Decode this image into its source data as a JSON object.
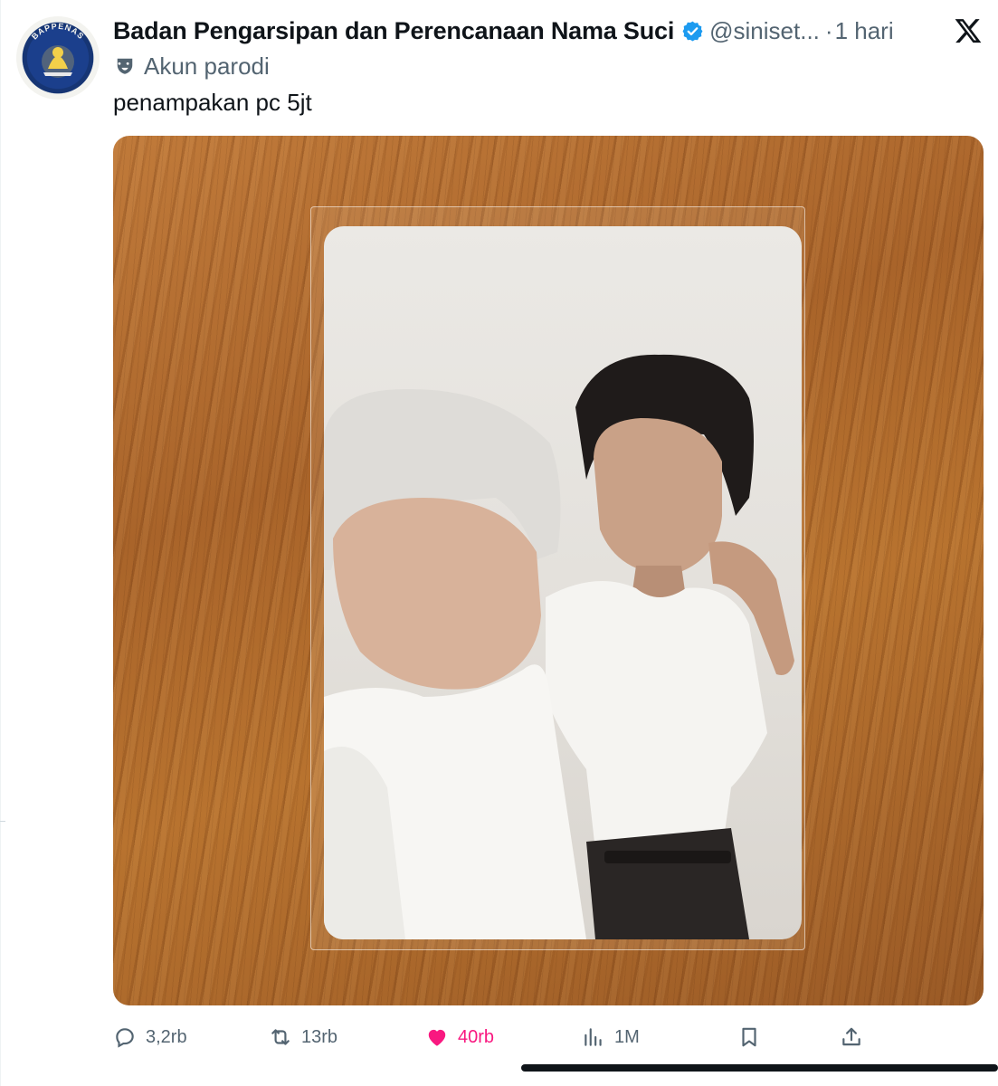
{
  "post": {
    "display_name": "Badan Pengarsipan dan Perencanaan Nama Suci",
    "handle": "@siniset...",
    "separator": "·",
    "time": "1 hari",
    "label": "Akun parodi",
    "text": "penampakan pc 5jt"
  },
  "avatar": {
    "top_text": "BAPPENAS",
    "ring_text": "Badan Pengarsipan dan Perencanaan Nama Suci"
  },
  "media": {
    "description_icon": "photo"
  },
  "actions": {
    "reply_count": "3,2rb",
    "repost_count": "13rb",
    "like_count": "40rb",
    "view_count": "1M"
  },
  "icons": {
    "verified": "verified-badge-icon",
    "platform": "x-logo-icon",
    "parody": "parody-mask-icon",
    "reply": "reply-icon",
    "repost": "repost-icon",
    "like": "heart-icon",
    "views": "views-icon",
    "bookmark": "bookmark-icon",
    "share": "share-icon"
  },
  "colors": {
    "text": "#0f1419",
    "secondary": "#536471",
    "verified": "#1d9bf0",
    "like": "#f91880"
  }
}
